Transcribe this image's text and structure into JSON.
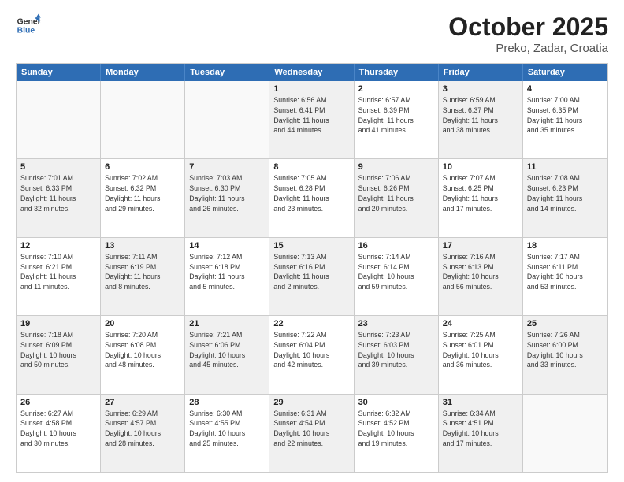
{
  "header": {
    "logo_line1": "General",
    "logo_line2": "Blue",
    "title": "October 2025",
    "subtitle": "Preko, Zadar, Croatia"
  },
  "calendar": {
    "days_of_week": [
      "Sunday",
      "Monday",
      "Tuesday",
      "Wednesday",
      "Thursday",
      "Friday",
      "Saturday"
    ],
    "weeks": [
      [
        {
          "day": "",
          "info": "",
          "empty": true
        },
        {
          "day": "",
          "info": "",
          "empty": true
        },
        {
          "day": "",
          "info": "",
          "empty": true
        },
        {
          "day": "1",
          "info": "Sunrise: 6:56 AM\nSunset: 6:41 PM\nDaylight: 11 hours\nand 44 minutes.",
          "shaded": true
        },
        {
          "day": "2",
          "info": "Sunrise: 6:57 AM\nSunset: 6:39 PM\nDaylight: 11 hours\nand 41 minutes.",
          "shaded": false
        },
        {
          "day": "3",
          "info": "Sunrise: 6:59 AM\nSunset: 6:37 PM\nDaylight: 11 hours\nand 38 minutes.",
          "shaded": true
        },
        {
          "day": "4",
          "info": "Sunrise: 7:00 AM\nSunset: 6:35 PM\nDaylight: 11 hours\nand 35 minutes.",
          "shaded": false
        }
      ],
      [
        {
          "day": "5",
          "info": "Sunrise: 7:01 AM\nSunset: 6:33 PM\nDaylight: 11 hours\nand 32 minutes.",
          "shaded": true
        },
        {
          "day": "6",
          "info": "Sunrise: 7:02 AM\nSunset: 6:32 PM\nDaylight: 11 hours\nand 29 minutes.",
          "shaded": false
        },
        {
          "day": "7",
          "info": "Sunrise: 7:03 AM\nSunset: 6:30 PM\nDaylight: 11 hours\nand 26 minutes.",
          "shaded": true
        },
        {
          "day": "8",
          "info": "Sunrise: 7:05 AM\nSunset: 6:28 PM\nDaylight: 11 hours\nand 23 minutes.",
          "shaded": false
        },
        {
          "day": "9",
          "info": "Sunrise: 7:06 AM\nSunset: 6:26 PM\nDaylight: 11 hours\nand 20 minutes.",
          "shaded": true
        },
        {
          "day": "10",
          "info": "Sunrise: 7:07 AM\nSunset: 6:25 PM\nDaylight: 11 hours\nand 17 minutes.",
          "shaded": false
        },
        {
          "day": "11",
          "info": "Sunrise: 7:08 AM\nSunset: 6:23 PM\nDaylight: 11 hours\nand 14 minutes.",
          "shaded": true
        }
      ],
      [
        {
          "day": "12",
          "info": "Sunrise: 7:10 AM\nSunset: 6:21 PM\nDaylight: 11 hours\nand 11 minutes.",
          "shaded": false
        },
        {
          "day": "13",
          "info": "Sunrise: 7:11 AM\nSunset: 6:19 PM\nDaylight: 11 hours\nand 8 minutes.",
          "shaded": true
        },
        {
          "day": "14",
          "info": "Sunrise: 7:12 AM\nSunset: 6:18 PM\nDaylight: 11 hours\nand 5 minutes.",
          "shaded": false
        },
        {
          "day": "15",
          "info": "Sunrise: 7:13 AM\nSunset: 6:16 PM\nDaylight: 11 hours\nand 2 minutes.",
          "shaded": true
        },
        {
          "day": "16",
          "info": "Sunrise: 7:14 AM\nSunset: 6:14 PM\nDaylight: 10 hours\nand 59 minutes.",
          "shaded": false
        },
        {
          "day": "17",
          "info": "Sunrise: 7:16 AM\nSunset: 6:13 PM\nDaylight: 10 hours\nand 56 minutes.",
          "shaded": true
        },
        {
          "day": "18",
          "info": "Sunrise: 7:17 AM\nSunset: 6:11 PM\nDaylight: 10 hours\nand 53 minutes.",
          "shaded": false
        }
      ],
      [
        {
          "day": "19",
          "info": "Sunrise: 7:18 AM\nSunset: 6:09 PM\nDaylight: 10 hours\nand 50 minutes.",
          "shaded": true
        },
        {
          "day": "20",
          "info": "Sunrise: 7:20 AM\nSunset: 6:08 PM\nDaylight: 10 hours\nand 48 minutes.",
          "shaded": false
        },
        {
          "day": "21",
          "info": "Sunrise: 7:21 AM\nSunset: 6:06 PM\nDaylight: 10 hours\nand 45 minutes.",
          "shaded": true
        },
        {
          "day": "22",
          "info": "Sunrise: 7:22 AM\nSunset: 6:04 PM\nDaylight: 10 hours\nand 42 minutes.",
          "shaded": false
        },
        {
          "day": "23",
          "info": "Sunrise: 7:23 AM\nSunset: 6:03 PM\nDaylight: 10 hours\nand 39 minutes.",
          "shaded": true
        },
        {
          "day": "24",
          "info": "Sunrise: 7:25 AM\nSunset: 6:01 PM\nDaylight: 10 hours\nand 36 minutes.",
          "shaded": false
        },
        {
          "day": "25",
          "info": "Sunrise: 7:26 AM\nSunset: 6:00 PM\nDaylight: 10 hours\nand 33 minutes.",
          "shaded": true
        }
      ],
      [
        {
          "day": "26",
          "info": "Sunrise: 6:27 AM\nSunset: 4:58 PM\nDaylight: 10 hours\nand 30 minutes.",
          "shaded": false
        },
        {
          "day": "27",
          "info": "Sunrise: 6:29 AM\nSunset: 4:57 PM\nDaylight: 10 hours\nand 28 minutes.",
          "shaded": true
        },
        {
          "day": "28",
          "info": "Sunrise: 6:30 AM\nSunset: 4:55 PM\nDaylight: 10 hours\nand 25 minutes.",
          "shaded": false
        },
        {
          "day": "29",
          "info": "Sunrise: 6:31 AM\nSunset: 4:54 PM\nDaylight: 10 hours\nand 22 minutes.",
          "shaded": true
        },
        {
          "day": "30",
          "info": "Sunrise: 6:32 AM\nSunset: 4:52 PM\nDaylight: 10 hours\nand 19 minutes.",
          "shaded": false
        },
        {
          "day": "31",
          "info": "Sunrise: 6:34 AM\nSunset: 4:51 PM\nDaylight: 10 hours\nand 17 minutes.",
          "shaded": true
        },
        {
          "day": "",
          "info": "",
          "empty": true
        }
      ]
    ]
  }
}
